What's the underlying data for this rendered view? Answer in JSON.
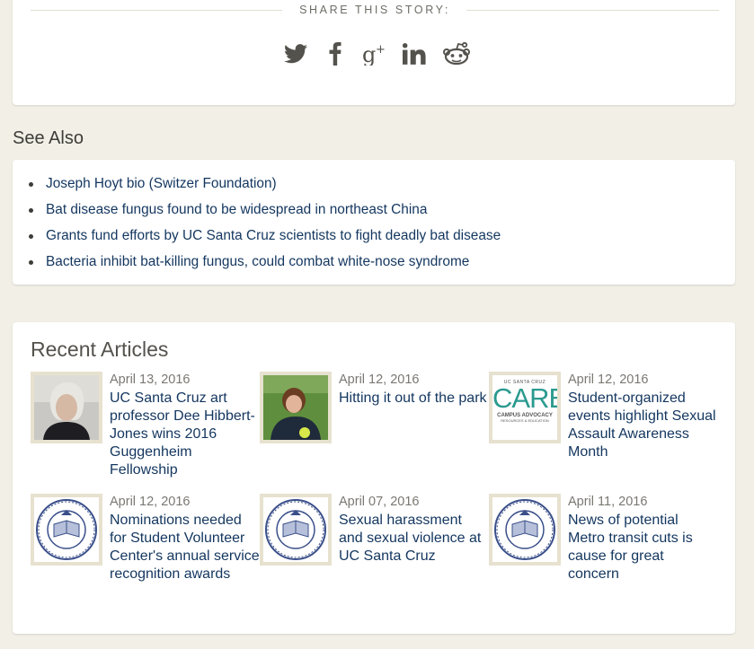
{
  "share": {
    "label": "SHARE THIS STORY:",
    "icons": [
      "twitter-icon",
      "facebook-icon",
      "google-plus-icon",
      "linkedin-icon",
      "reddit-icon"
    ]
  },
  "see_also": {
    "heading": "See Also",
    "items": [
      "Joseph Hoyt bio (Switzer Foundation)",
      "Bat disease fungus found to be widespread in northeast China",
      "Grants fund efforts by UC Santa Cruz scientists to fight deadly bat disease",
      "Bacteria inhibit bat-killing fungus, could combat white-nose syndrome"
    ]
  },
  "recent": {
    "heading": "Recent Articles",
    "articles": [
      {
        "date": "April 13, 2016",
        "title": "UC Santa Cruz art professor Dee Hibbert-Jones wins 2016 Guggenheim Fellowship",
        "thumb": "portrait"
      },
      {
        "date": "April 12, 2016",
        "title": "Hitting it out of the park",
        "thumb": "softball-player"
      },
      {
        "date": "April 12, 2016",
        "title": "Student-organized events highlight Sexual Assault Awareness Month",
        "thumb": "care-logo"
      },
      {
        "date": "April 12, 2016",
        "title": "Nominations needed for Student Volunteer Center's annual service recognition awards",
        "thumb": "uc-seal"
      },
      {
        "date": "April 07, 2016",
        "title": "Sexual harassment and sexual violence at UC Santa Cruz",
        "thumb": "uc-seal"
      },
      {
        "date": "April 11, 2016",
        "title": "News of potential Metro transit cuts is cause for great concern",
        "thumb": "uc-seal"
      }
    ],
    "care_logo": {
      "top": "UC SANTA CRUZ",
      "word": "CARE",
      "bottom": "CAMPUS ADVOCACY",
      "bottom2": "RESOURCES & EDUCATION"
    }
  },
  "colors": {
    "background": "#f1efe6",
    "link": "#13365f",
    "thumb_frame": "#e7e1cf",
    "care_teal": "#2b9a8f",
    "seal_blue": "#3a4f8a"
  }
}
